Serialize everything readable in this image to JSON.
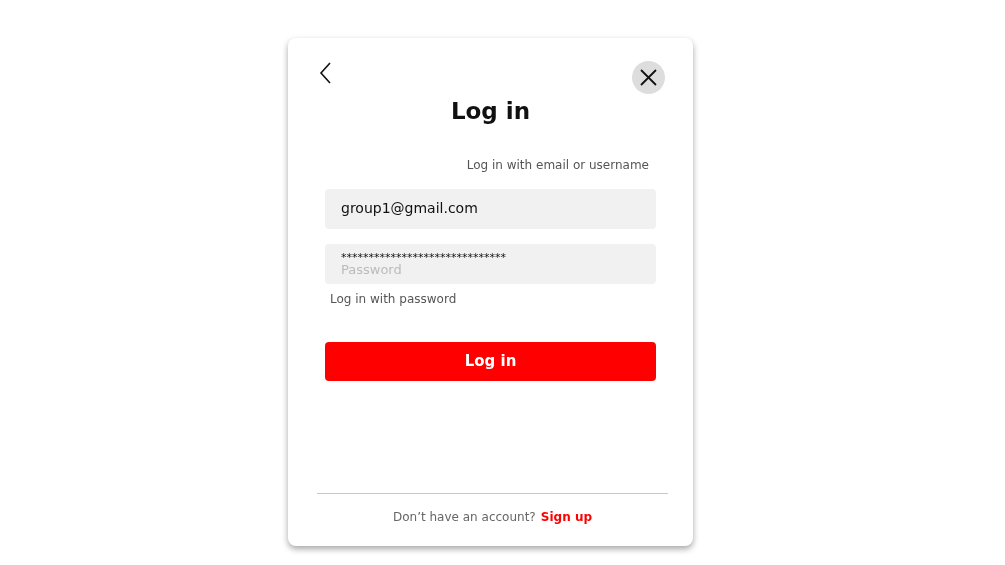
{
  "title": "Log in",
  "mode_link": "Log in with email or username",
  "email": {
    "value": "group1@gmail.com"
  },
  "password": {
    "value": "******************************",
    "placeholder": "Password"
  },
  "alt_link": "Log in with password",
  "submit": "Log in",
  "footer": {
    "text": "Don’t have an account?",
    "link": "Sign up"
  }
}
